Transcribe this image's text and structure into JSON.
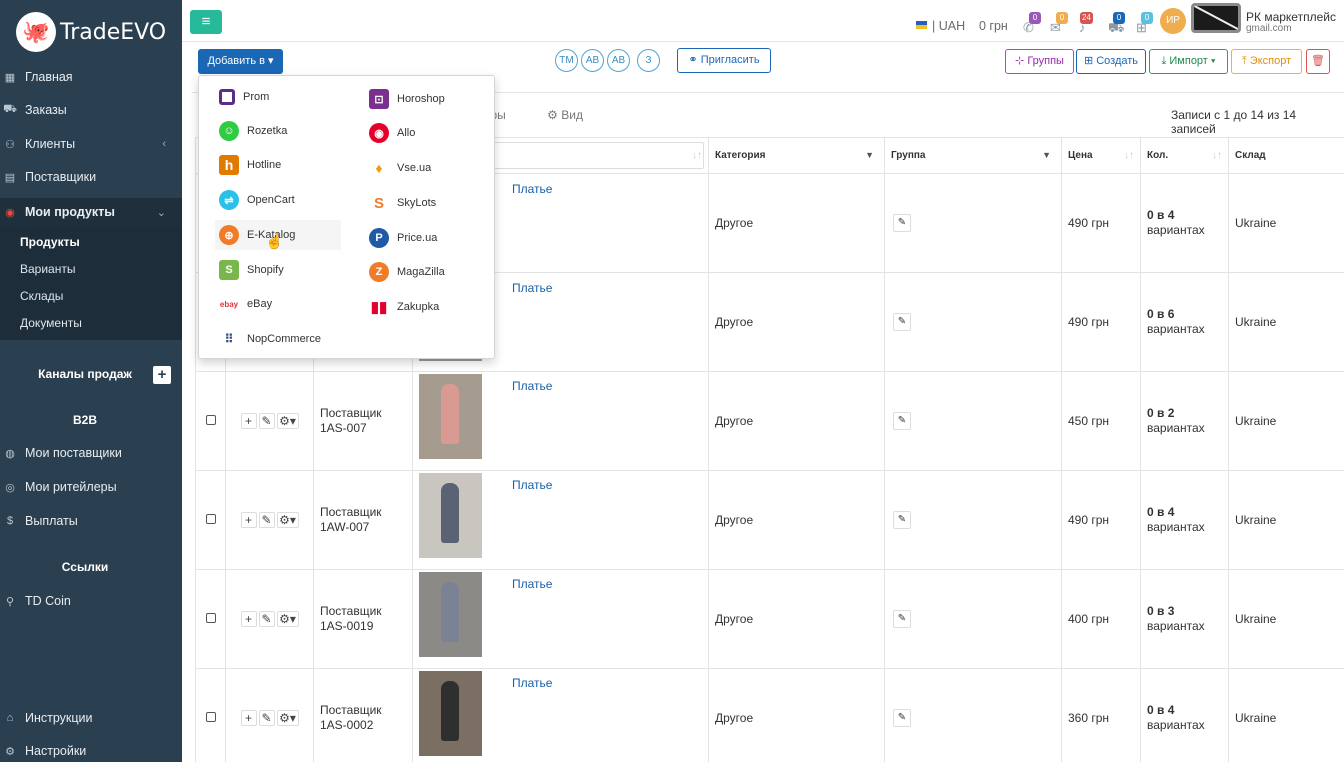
{
  "logo": {
    "text": "TradeEVO"
  },
  "sidebar": {
    "items": [
      {
        "label": "Главная",
        "icon": "grid-icon"
      },
      {
        "label": "Заказы",
        "icon": "truck-icon"
      },
      {
        "label": "Клиенты",
        "icon": "user-icon"
      },
      {
        "label": "Поставщики",
        "icon": "database-icon"
      },
      {
        "label": "Мои продукты",
        "icon": "product-icon"
      }
    ],
    "submenu": [
      "Продукты",
      "Варианты",
      "Склады",
      "Документы"
    ],
    "sales_channels": "Каналы продаж",
    "b2b": "B2B",
    "b2b_items": [
      {
        "label": "Мои поставщики"
      },
      {
        "label": "Мои ритейлеры"
      },
      {
        "label": "Выплаты",
        "glyph": "$"
      }
    ],
    "links": "Ссылки",
    "td_coin": "TD Coin",
    "bottom": [
      "Инструкции",
      "Настройки"
    ]
  },
  "topbar": {
    "currency": "| UAH",
    "balance": "0 грн",
    "badges": [
      "0",
      "0",
      "24",
      "0",
      "0"
    ],
    "avatar": "ИР",
    "user_name": "РК маркетплейс",
    "user_email": "gmail.com"
  },
  "toolbar": {
    "add_label": "Добавить в",
    "circles": [
      "TM",
      "AB",
      "AB",
      "З"
    ],
    "invite": "Пригласить",
    "groups": "Группы",
    "create": "Создать",
    "import": "Импорт",
    "export": "Экспорт"
  },
  "view": {
    "filters": "тры",
    "view": "Вид"
  },
  "records": "Записи с 1 до 14 из 14 записей",
  "columns": {
    "category": "Категория",
    "group": "Группа",
    "price": "Цена",
    "qty": "Кол.",
    "warehouse": "Склад"
  },
  "rows": [
    {
      "supplier": "",
      "code": "",
      "name": "Платье",
      "category": "Другое",
      "price": "490 грн",
      "count": "0",
      "of": "в 4",
      "variants": "вариантах",
      "warehouse": "Ukraine"
    },
    {
      "supplier": "",
      "code": "",
      "name": "Платье",
      "category": "Другое",
      "price": "490 грн",
      "count": "0",
      "of": "в 6",
      "variants": "вариантах",
      "warehouse": "Ukraine"
    },
    {
      "supplier": "Поставщик",
      "code": "1AS-007",
      "name": "Платье",
      "category": "Другое",
      "price": "450 грн",
      "count": "0",
      "of": "в 2",
      "variants": "вариантах",
      "warehouse": "Ukraine"
    },
    {
      "supplier": "Поставщик",
      "code": "1AW-007",
      "name": "Платье",
      "category": "Другое",
      "price": "490 грн",
      "count": "0",
      "of": "в 4",
      "variants": "вариантах",
      "warehouse": "Ukraine"
    },
    {
      "supplier": "Поставщик",
      "code": "1AS-0019",
      "name": "Платье",
      "category": "Другое",
      "price": "400 грн",
      "count": "0",
      "of": "в 3",
      "variants": "вариантах",
      "warehouse": "Ukraine"
    },
    {
      "supplier": "Поставщик",
      "code": "1AS-0002",
      "name": "Платье",
      "category": "Другое",
      "price": "360 грн",
      "count": "0",
      "of": "в 4",
      "variants": "вариантах",
      "warehouse": "Ukraine"
    }
  ],
  "dropdown": {
    "left": [
      "Prom",
      "Rozetka",
      "Hotline",
      "OpenCart",
      "E-Katalog",
      "Shopify",
      "eBay",
      "NopCommerce"
    ],
    "right": [
      "Horoshop",
      "Allo",
      "Vse.ua",
      "SkyLots",
      "Price.ua",
      "MagaZilla",
      "Zakupka"
    ]
  },
  "colors": {
    "sidebar": "#2a3f50",
    "primary": "#1a67b5",
    "accent": "#26b99a"
  }
}
